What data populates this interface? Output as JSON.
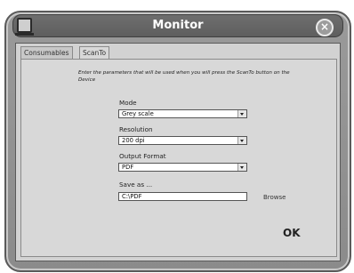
{
  "window": {
    "title": "Monitor",
    "close_symbol": "×"
  },
  "tabs": [
    {
      "label": "Consumables",
      "active": false
    },
    {
      "label": "ScanTo",
      "active": true
    }
  ],
  "scanto": {
    "instructions": "Enter the parameters that will be used when you will press the ScanTo button on the Device",
    "mode": {
      "label": "Mode",
      "value": "Grey scale"
    },
    "resolution": {
      "label": "Resolution",
      "value": "200 dpi"
    },
    "output_format": {
      "label": "Output Format",
      "value": "PDF"
    },
    "save_as": {
      "label": "Save as ...",
      "value": "C:\\PDF"
    },
    "browse_label": "Browse",
    "ok_label": "OK"
  },
  "icons": {
    "app": "monitor-icon",
    "close": "close-icon",
    "dropdown": "chevron-down-icon"
  }
}
